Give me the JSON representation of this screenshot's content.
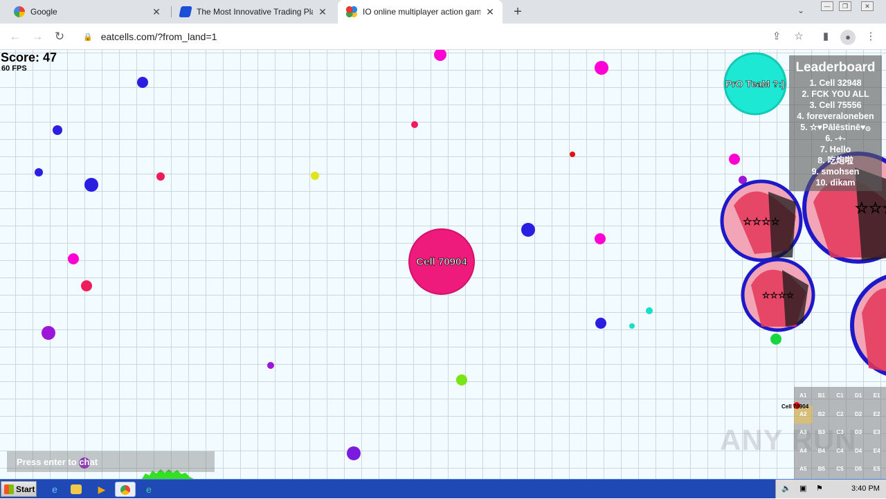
{
  "browser": {
    "tabs": [
      {
        "title": "Google",
        "favicon_color": "#4285f4",
        "active": false
      },
      {
        "title": "The Most Innovative Trading Platform",
        "favicon_color": "#1b4fd8",
        "active": false
      },
      {
        "title": "IO online multiplayer action game. Si",
        "favicon_color": "#f4b400",
        "active": true
      }
    ],
    "url": "eatcells.com/?from_land=1"
  },
  "hud": {
    "score_text": "Score: 47",
    "fps_text": "60 FPS",
    "chat_placeholder": "Press enter to chat",
    "watermark": "ANY RUN"
  },
  "leaderboard": {
    "title": "Leaderboard",
    "entries": [
      "1. Cell 32948",
      "2. FCK YOU ALL",
      "3. Cell 75556",
      "4. foreveraloneben",
      "5. ✫♥Pālēstinē♥۞",
      "6. -+-",
      "7. Hello",
      "8. 吃炮啦",
      "9. smohsen",
      "10. dikam"
    ]
  },
  "player": {
    "name": "Cell 70904",
    "color": "#ef1b7c",
    "score": 47
  },
  "other_cells": [
    {
      "name": "PrO TeaM ?:)",
      "color": "#1de8d4"
    },
    {
      "name": "☆☆☆☆",
      "color": "#1d19c9"
    }
  ],
  "minimap": {
    "cells": [
      "A1",
      "B1",
      "C1",
      "D1",
      "E1",
      "A2",
      "B2",
      "C2",
      "D2",
      "E2",
      "A3",
      "B3",
      "C3",
      "D3",
      "E3",
      "A4",
      "B4",
      "C4",
      "D4",
      "E4",
      "A5",
      "B5",
      "C5",
      "D5",
      "E5"
    ],
    "current": "A2",
    "player_label": "Cell 70904"
  },
  "taskbar": {
    "start_label": "Start",
    "clock": "3:40 PM"
  },
  "colors": {
    "pellet_palette": [
      "#ff00d4",
      "#2a1fe0",
      "#ef1b5a",
      "#dfe51a",
      "#7b1be0",
      "#9b16d8",
      "#7ae514",
      "#12e0c8",
      "#e01212",
      "#18d640"
    ]
  }
}
